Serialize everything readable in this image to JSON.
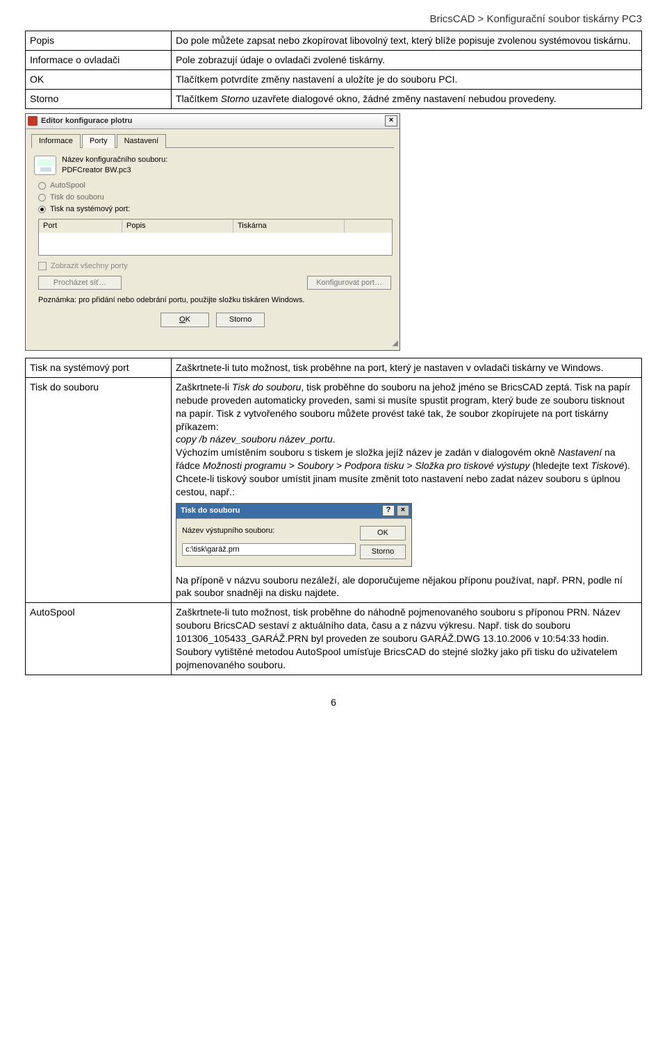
{
  "header": {
    "breadcrumb": "BricsCAD > Konfigurační soubor tiskárny PC3"
  },
  "table1": {
    "rows": [
      {
        "term": "Popis",
        "desc": "Do pole můžete zapsat nebo zkopírovat libovolný text, který blíže popisuje zvolenou systémovou tiskárnu."
      },
      {
        "term": "Informace o ovladači",
        "desc": "Pole zobrazují údaje o ovladači zvolené tiskárny."
      },
      {
        "term": "OK",
        "desc": "Tlačítkem potvrdíte změny nastavení a uložíte je do souboru PCI."
      },
      {
        "term": "Storno",
        "desc_pre": "Tlačítkem ",
        "desc_it": "Storno",
        "desc_post": " uzavřete dialogové okno, žádné změny nastavení nebudou provedeny."
      }
    ]
  },
  "dialog1": {
    "title": "Editor konfigurace plotru",
    "close": "×",
    "tabs": [
      "Informace",
      "Porty",
      "Nastavení"
    ],
    "label_hdr": "Název konfiguračního souboru:",
    "filename": "PDFCreator BW.pc3",
    "radios": {
      "autospool": "AutoSpool",
      "tisk_soubor": "Tisk do souboru",
      "tisk_sysport": "Tisk na systémový port:"
    },
    "port_headers": {
      "port": "Port",
      "popis": "Popis",
      "tiskarna": "Tiskárna"
    },
    "chk_all": "Zobrazit všechny porty",
    "btn_browse": "Procházet síť…",
    "btn_cfgport": "Konfigurovat port…",
    "note": "Poznámka: pro přidání nebo odebrání portu, použijte složku tiskáren Windows.",
    "ok_u": "O",
    "ok_rest": "K",
    "storno": "Storno"
  },
  "table2": {
    "r1_term": "Tisk na systémový port",
    "r1_desc": "Zaškrtnete-li tuto možnost, tisk proběhne na port, který je nastaven v ovladači tiskárny ve Windows.",
    "r2_term": "Tisk do souboru",
    "r2_p1_pre": "Zaškrtnete-li ",
    "r2_p1_it1": "Tisk do souboru",
    "r2_p1_mid": ", tisk proběhne do souboru na jehož jméno se BricsCAD zeptá. Tisk na papír nebude proveden automaticky proveden, sami si musíte spustit program, který bude ze souboru tisknout na papír. Tisk z vytvořeného souboru můžete provést také tak, že soubor zkopírujete na port tiskárny příkazem:",
    "r2_p1_it2": "copy /b název_souboru název_portu",
    "r2_p1_end": ".",
    "r2_p2_pre": "Výchozím umístěním souboru s tiskem je složka jejíž název je zadán v dialogovém okně ",
    "r2_p2_it1": "Nastavení",
    "r2_p2_mid1": " na řádce ",
    "r2_p2_it2": "Možnosti programu > Soubory > Podpora tisku > Složka pro tiskové výstupy",
    "r2_p2_mid2": " (hledejte text ",
    "r2_p2_it3": "Tiskové",
    "r2_p2_end": "). Chcete-li tiskový soubor umístit jinam musíte změnit toto nastavení nebo zadat název souboru s úplnou cestou, např.:",
    "r2_p3": "Na příponě v názvu souboru nezáleží, ale doporučujeme nějakou příponu používat, např. PRN, podle ní pak soubor snadněji na disku najdete.",
    "r3_term": "AutoSpool",
    "r3_p1": "Zaškrtnete-li tuto možnost, tisk proběhne do náhodně pojmenovaného souboru s příponou PRN. Název souboru BricsCAD sestaví z aktuálního data, času a z názvu výkresu. Např. tisk do souboru 101306_105433_GARÁŽ.PRN byl proveden ze souboru GARÁŽ.DWG 13.10.2006 v 10:54:33 hodin.",
    "r3_p2": "Soubory vytištěné metodou AutoSpool umísťuje BricsCAD do stejné složky jako při tisku do uživatelem pojmenovaného souboru."
  },
  "dialog2": {
    "title": "Tisk do souboru",
    "help": "?",
    "close": "×",
    "label": "Název výstupního souboru:",
    "value": "c:\\tisk\\garáž.prn",
    "ok": "OK",
    "storno": "Storno"
  },
  "page_number": "6"
}
